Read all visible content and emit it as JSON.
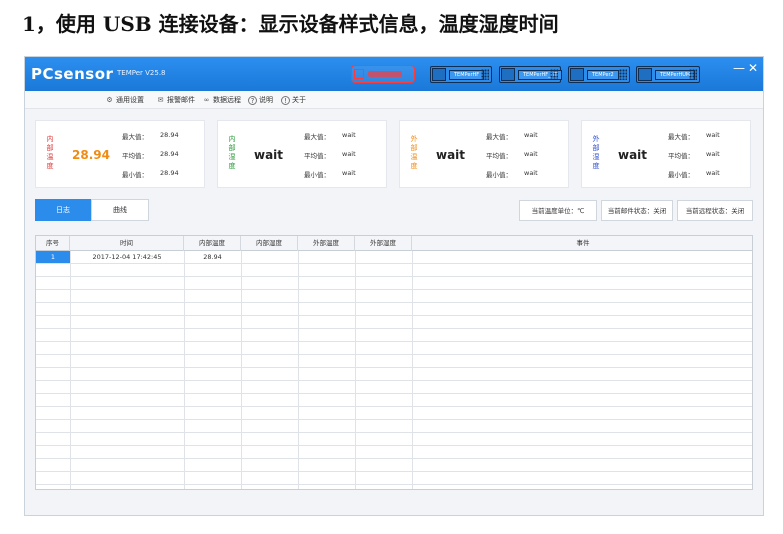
{
  "heading": "1，使用 USB 连接设备：显示设备样式信息，温度湿度时间",
  "window": {
    "logo": "PCsensor",
    "version": "TEMPer V25.8",
    "devices": [
      "TEMPerHF",
      "TEMPerHF_HT",
      "TEMPer2",
      "TEMPerHUM"
    ],
    "controls": {
      "minimize": "—",
      "close": "✕"
    }
  },
  "menu": [
    {
      "icon": "gear-icon",
      "glyph": "⚙",
      "label": "通用设置"
    },
    {
      "icon": "mail-icon",
      "glyph": "✉",
      "label": "报警邮件"
    },
    {
      "icon": "link-icon",
      "glyph": "∞",
      "label": "数据远程"
    },
    {
      "icon": "help-icon",
      "glyph": "?",
      "label": "说明"
    },
    {
      "icon": "info-icon",
      "glyph": "!",
      "label": "关于"
    }
  ],
  "stat_labels": {
    "max": "最大值：",
    "avg": "平均值：",
    "min": "最小值："
  },
  "cards": [
    {
      "label": "内部温度",
      "label_color": "#e03a3a",
      "value": "28.94",
      "value_color": "#f08c14",
      "max": "28.94",
      "avg": "28.94",
      "min": "28.94"
    },
    {
      "label": "内部湿度",
      "label_color": "#2a9a3a",
      "value": "wait",
      "value_color": "#222222",
      "max": "wait",
      "avg": "wait",
      "min": "wait"
    },
    {
      "label": "外部温度",
      "label_color": "#f08c14",
      "value": "wait",
      "value_color": "#222222",
      "max": "wait",
      "avg": "wait",
      "min": "wait"
    },
    {
      "label": "外部湿度",
      "label_color": "#2f4fd0",
      "value": "wait",
      "value_color": "#222222",
      "max": "wait",
      "avg": "wait",
      "min": "wait"
    }
  ],
  "tabs": [
    {
      "label": "日志",
      "active": true
    },
    {
      "label": "曲线",
      "active": false
    }
  ],
  "status_buttons": [
    "当前温度单位：℃",
    "当前邮件状态：关闭",
    "当前远程状态：关闭"
  ],
  "table": {
    "columns": [
      "序号",
      "时间",
      "内部温度",
      "内部湿度",
      "外部温度",
      "外部湿度",
      "事件"
    ],
    "rows": [
      [
        "1",
        "2017-12-04 17:42:45",
        "28.94",
        "",
        "",
        "",
        ""
      ]
    ]
  },
  "colors": {
    "accent": "#2b8ceb",
    "titlebar": "#1a78d8"
  }
}
